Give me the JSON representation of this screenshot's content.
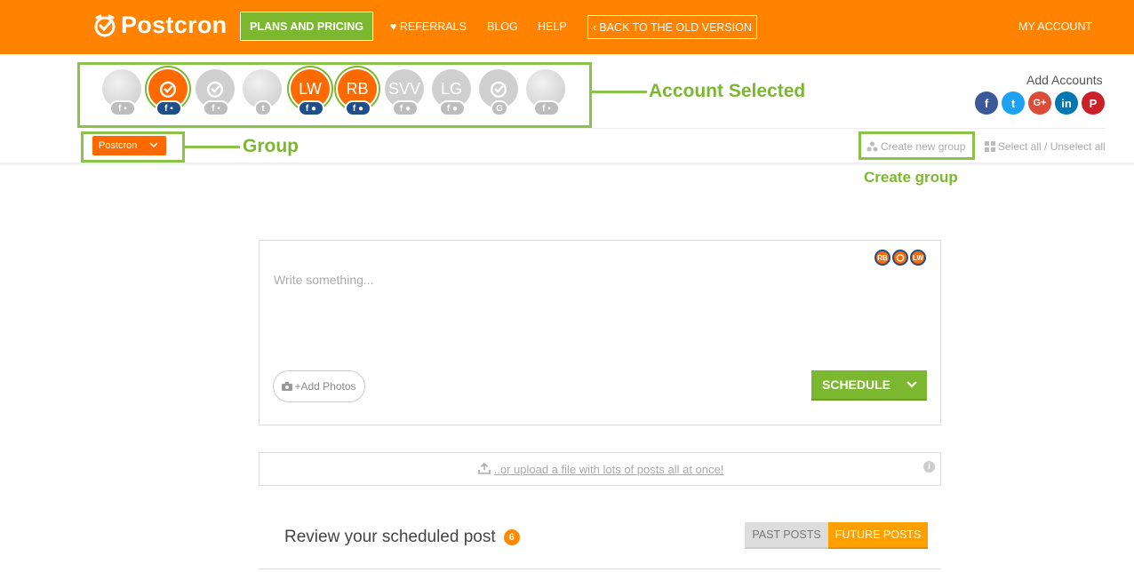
{
  "header": {
    "logo_text": "Postcron",
    "nav": {
      "plans": "PLANS AND PRICING",
      "referrals": "REFERRALS",
      "blog": "BLOG",
      "help": "HELP",
      "back": "BACK TO THE OLD VERSION",
      "account": "MY ACCOUNT"
    }
  },
  "accounts": [
    {
      "initials": "",
      "selected": false,
      "badge": "f  ▪"
    },
    {
      "initials": "",
      "selected": true,
      "badge": "f  ▪"
    },
    {
      "initials": "",
      "selected": false,
      "badge": "f  ▪"
    },
    {
      "initials": "",
      "selected": false,
      "badge": "t"
    },
    {
      "initials": "LW",
      "selected": true,
      "badge": "f  ●"
    },
    {
      "initials": "RB",
      "selected": true,
      "badge": "f  ●"
    },
    {
      "initials": "SVV",
      "selected": false,
      "badge": "f  ●"
    },
    {
      "initials": "LG",
      "selected": false,
      "badge": "f  ●"
    },
    {
      "initials": "",
      "selected": false,
      "badge": "G"
    },
    {
      "initials": "",
      "selected": false,
      "badge": "f  ▪"
    }
  ],
  "add_accounts": {
    "title": "Add Accounts",
    "networks": [
      {
        "glyph": "f",
        "color": "#3b5998"
      },
      {
        "glyph": "t",
        "color": "#1da1f2"
      },
      {
        "glyph": "G+",
        "color": "#dd4b39"
      },
      {
        "glyph": "in",
        "color": "#0077b5"
      },
      {
        "glyph": "P",
        "color": "#cb2027"
      }
    ]
  },
  "group": {
    "selected": "Postcron",
    "create_label": "Create new group",
    "select_all_label": "Select all / Unselect all"
  },
  "annotations": {
    "account_selected": "Account Selected",
    "group": "Group",
    "create_group": "Create group"
  },
  "composer": {
    "placeholder": "Write something...",
    "selected_mini": [
      "RB",
      "",
      "LW"
    ],
    "add_photos": "+Add Photos",
    "schedule": "SCHEDULE"
  },
  "upload": {
    "text": "..or upload a file with lots of posts all at once!"
  },
  "review": {
    "title": "Review your scheduled post",
    "count": "6",
    "past": "PAST POSTS",
    "future": "FUTURE POSTS"
  },
  "colors": {
    "brand_orange": "#ff8200",
    "accent_green": "#7cb82f",
    "future_orange": "#ffa000"
  }
}
